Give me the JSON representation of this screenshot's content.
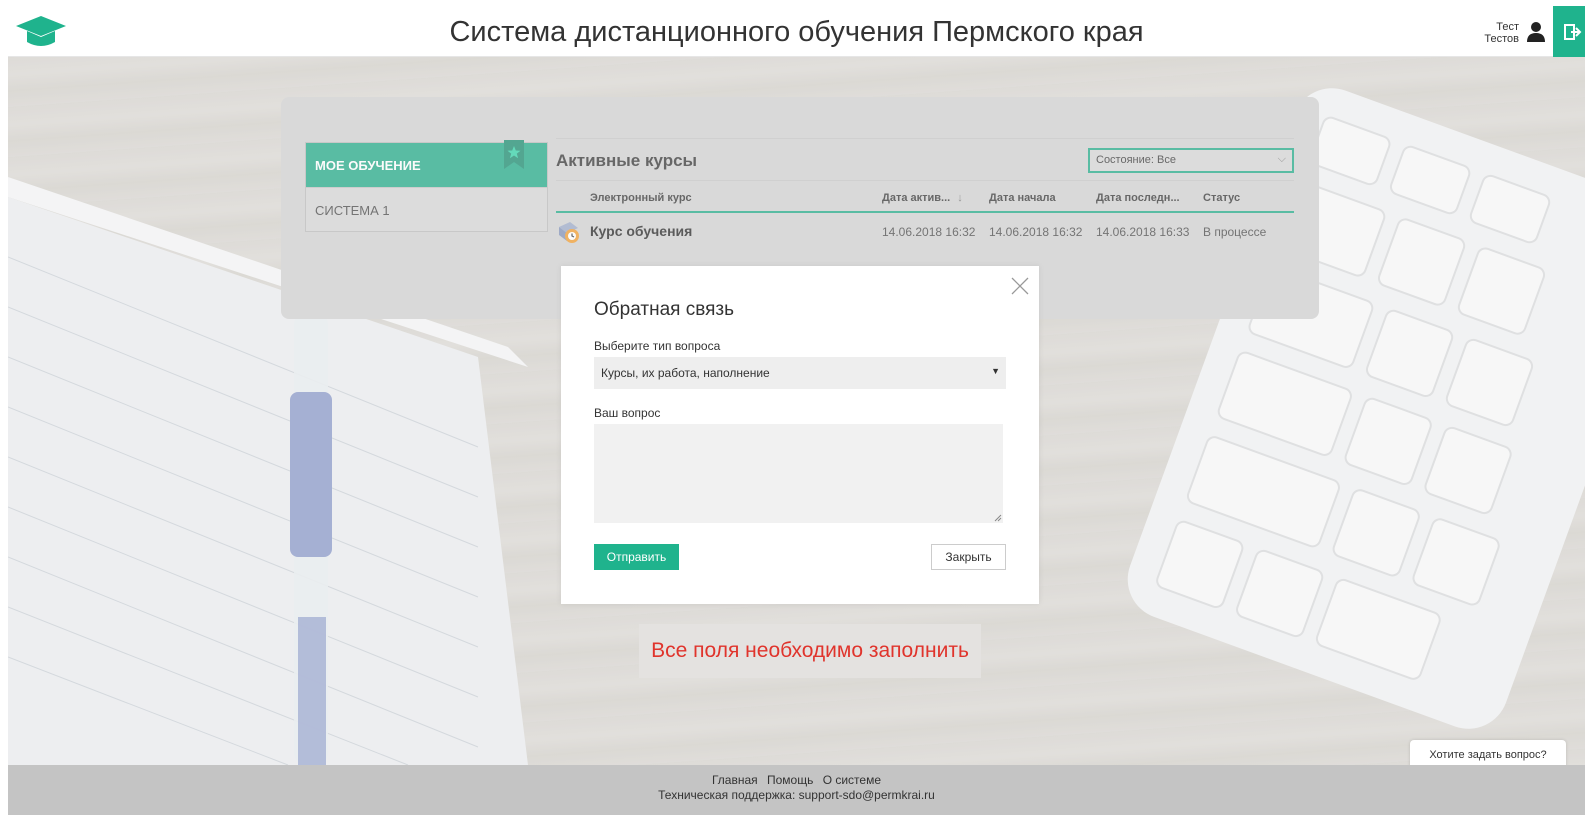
{
  "header": {
    "title": "Система дистанционного обучения Пермского края",
    "user_first": "Тест",
    "user_last": "Тестов",
    "accent": "#1fb38d"
  },
  "sidebar": {
    "items": [
      {
        "label": "МОЕ ОБУЧЕНИЕ",
        "active": true
      },
      {
        "label": "СИСТЕМА 1",
        "active": false
      }
    ]
  },
  "courses": {
    "title": "Активные курсы",
    "filter_label": "Состояние: Все",
    "columns": [
      "Электронный курс",
      "Дата актив...",
      "Дата начала",
      "Дата последн...",
      "Статус"
    ],
    "sort_indicator": "↓",
    "rows": [
      {
        "name": "Курс обучения",
        "activated": "14.06.2018 16:32",
        "started": "14.06.2018 16:32",
        "last": "14.06.2018 16:33",
        "status": "В процессе"
      }
    ]
  },
  "modal": {
    "title": "Обратная связь",
    "type_label": "Выберите тип вопроса",
    "type_value": "Курсы, их работа, наполнение",
    "question_label": "Ваш вопрос",
    "question_value": "",
    "send_label": "Отправить",
    "close_label": "Закрыть"
  },
  "error": {
    "text": "Все поля необходимо заполнить",
    "color": "#e0342c"
  },
  "help": {
    "label": "Хотите задать вопрос?"
  },
  "footer": {
    "links": [
      "Главная",
      "Помощь",
      "О системе"
    ],
    "support": "Техническая поддержка:  support-sdo@permkrai.ru"
  }
}
